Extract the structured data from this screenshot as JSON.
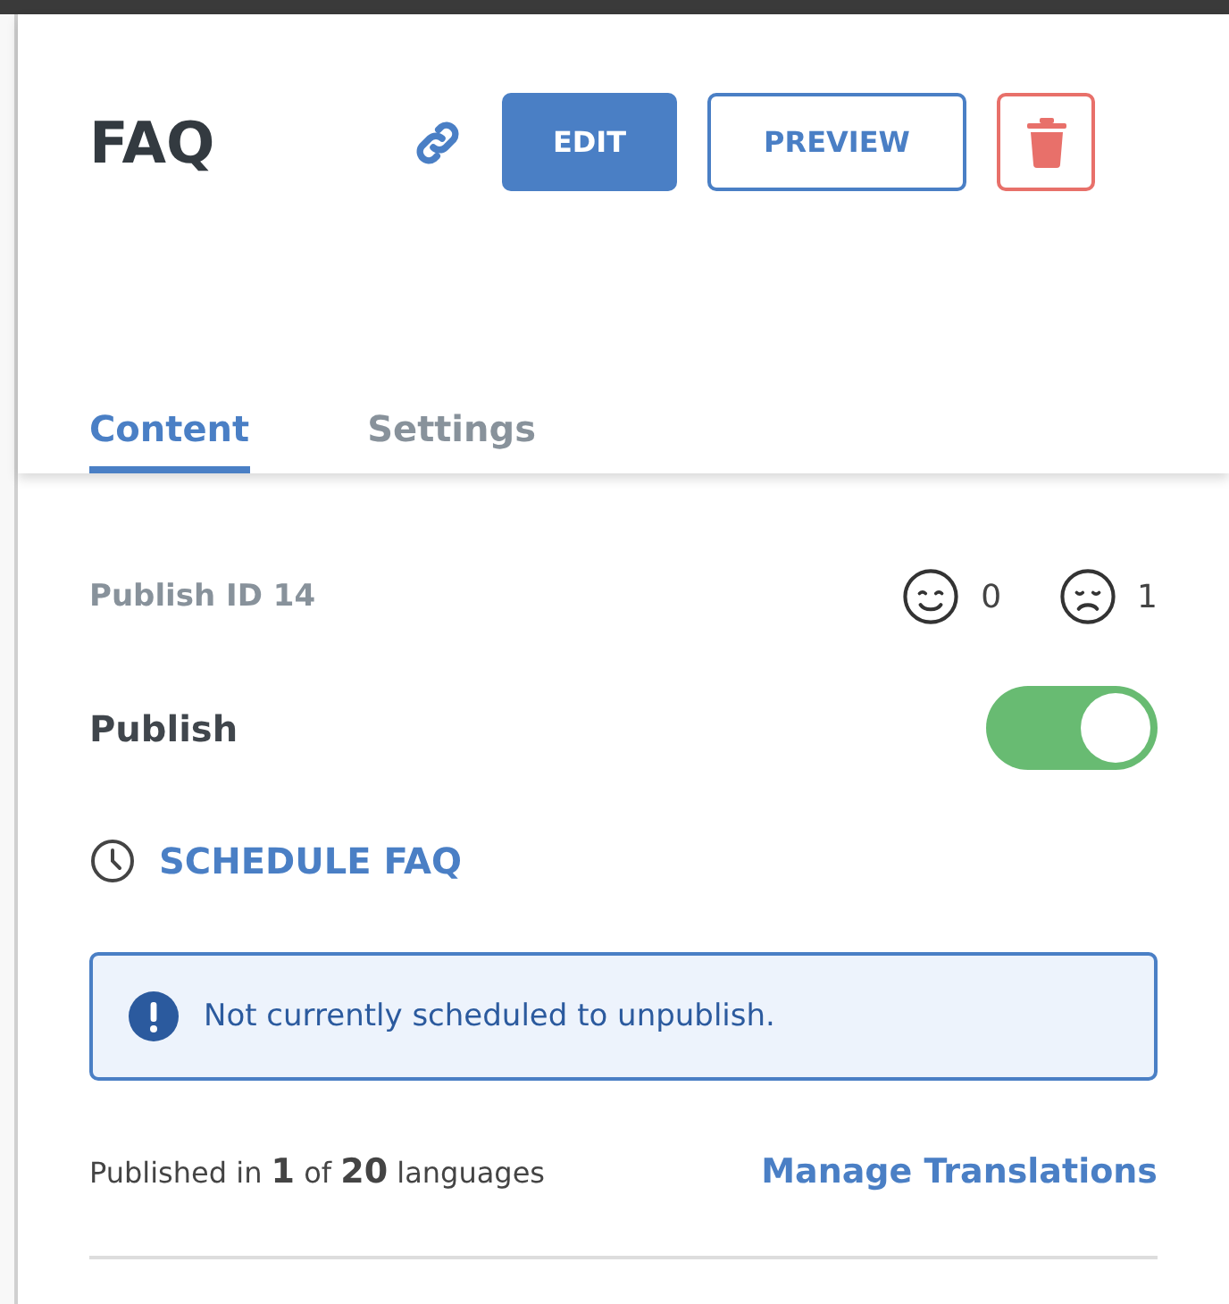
{
  "header": {
    "title": "FAQ",
    "buttons": [
      {
        "kind": "primary",
        "label": "EDIT"
      },
      {
        "kind": "outline",
        "label": "PREVIEW"
      },
      {
        "kind": "delete"
      }
    ]
  },
  "tabs": [
    {
      "label": "Content",
      "selected": true
    },
    {
      "label": "Settings",
      "selected": false
    }
  ],
  "publish_id": "Publish ID 14",
  "reactions": [
    {
      "kind": "happy",
      "count": "0"
    },
    {
      "kind": "sad",
      "count": "1"
    }
  ],
  "publish": {
    "label": "Publish",
    "on": true
  },
  "schedule_link": "SCHEDULE FAQ",
  "alert": "Not currently scheduled to unpublish.",
  "translations": {
    "summary": "Published in **1** of **20** languages",
    "link": "Manage Translations"
  }
}
